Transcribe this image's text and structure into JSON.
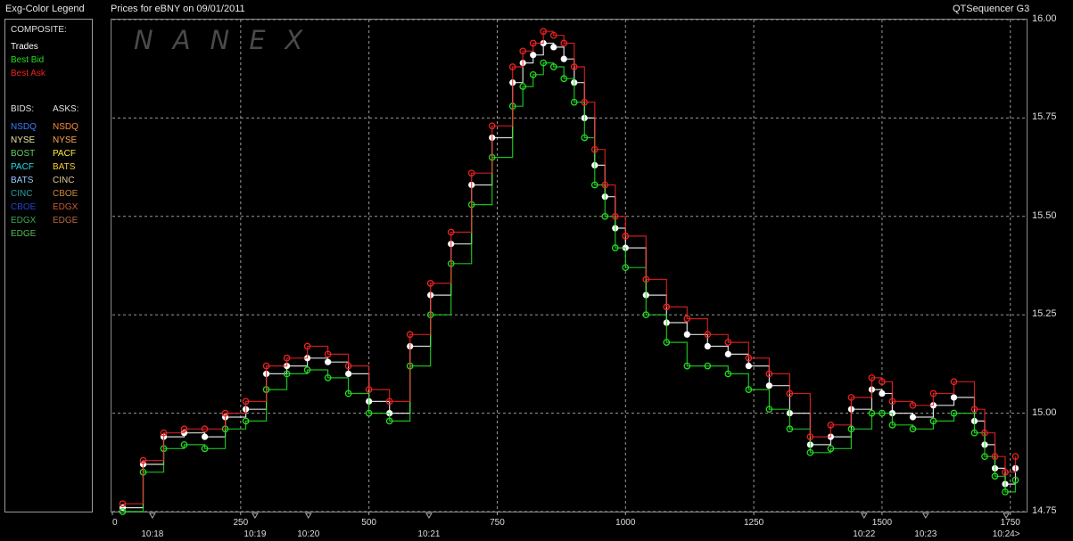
{
  "header": {
    "legend_title": "Exg-Color Legend",
    "chart_title": "Prices for  eBNY  on  09/01/2011",
    "app_name": "QTSequencer G3"
  },
  "watermark": "NANEX",
  "legend": {
    "composite_heading": "COMPOSITE:",
    "composite": [
      {
        "label": "Trades",
        "color": "#ffffff"
      },
      {
        "label": "Best Bid",
        "color": "#22dd22"
      },
      {
        "label": "Best Ask",
        "color": "#ee2222"
      }
    ],
    "bids_heading": "BIDS:",
    "asks_heading": "ASKS:",
    "bids": [
      {
        "label": "NSDQ",
        "color": "#3a7cff"
      },
      {
        "label": "NYSE",
        "color": "#e8e8a8"
      },
      {
        "label": "BOST",
        "color": "#66cc66"
      },
      {
        "label": "PACF",
        "color": "#22ddee"
      },
      {
        "label": "BATS",
        "color": "#99ccff"
      },
      {
        "label": "CINC",
        "color": "#22a0a0"
      },
      {
        "label": "CBOE",
        "color": "#2244cc"
      },
      {
        "label": "EDGX",
        "color": "#33aa55"
      },
      {
        "label": "EDGE",
        "color": "#55bb55"
      }
    ],
    "asks": [
      {
        "label": "NSDQ",
        "color": "#ff8833"
      },
      {
        "label": "NYSE",
        "color": "#ffaa55"
      },
      {
        "label": "PACF",
        "color": "#ffee44"
      },
      {
        "label": "BATS",
        "color": "#ffcc33"
      },
      {
        "label": "CINC",
        "color": "#ddcc99"
      },
      {
        "label": "CBOE",
        "color": "#cc8833"
      },
      {
        "label": "EDGX",
        "color": "#cc5533"
      },
      {
        "label": "EDGE",
        "color": "#bb6644"
      }
    ]
  },
  "chart_data": {
    "type": "line",
    "title": "Prices for  eBNY  on  09/01/2011",
    "xlim": [
      0,
      1780
    ],
    "ylim": [
      14.75,
      16.0
    ],
    "grid": true,
    "y_ticks": [
      "16.00",
      "15.75",
      "15.50",
      "15.25",
      "15.00",
      "14.75"
    ],
    "y_tick_values": [
      16.0,
      15.75,
      15.5,
      15.25,
      15.0,
      14.75
    ],
    "x_ticks": [
      "0",
      "250",
      "500",
      "750",
      "1000",
      "1250",
      "1500",
      "1750"
    ],
    "x_tick_values": [
      0,
      250,
      500,
      750,
      1000,
      1250,
      1500,
      1750
    ],
    "time_labels": [
      "10:18",
      "10:19",
      "10:20",
      "10:21",
      "10:22",
      "10:23",
      "10:24>"
    ],
    "time_label_positions": [
      78,
      278,
      382,
      617,
      1465,
      1585,
      1742
    ],
    "series": [
      {
        "name": "Trades",
        "color": "#ffffff",
        "x": [
          20,
          60,
          100,
          140,
          180,
          220,
          260,
          300,
          340,
          380,
          420,
          460,
          500,
          540,
          580,
          620,
          660,
          700,
          740,
          780,
          800,
          820,
          840,
          860,
          880,
          900,
          920,
          940,
          960,
          980,
          1000,
          1040,
          1080,
          1120,
          1160,
          1200,
          1240,
          1280,
          1320,
          1360,
          1400,
          1440,
          1480,
          1500,
          1520,
          1560,
          1600,
          1640,
          1680,
          1700,
          1720,
          1740,
          1760
        ],
        "values": [
          14.76,
          14.87,
          14.94,
          14.95,
          14.94,
          14.99,
          15.01,
          15.1,
          15.12,
          15.14,
          15.13,
          15.1,
          15.03,
          15.0,
          15.17,
          15.3,
          15.43,
          15.58,
          15.7,
          15.84,
          15.89,
          15.91,
          15.94,
          15.93,
          15.9,
          15.84,
          15.75,
          15.63,
          15.55,
          15.47,
          15.42,
          15.3,
          15.23,
          15.2,
          15.17,
          15.15,
          15.12,
          15.07,
          15.0,
          14.92,
          14.94,
          15.01,
          15.06,
          15.05,
          15.0,
          14.99,
          15.02,
          15.04,
          14.98,
          14.92,
          14.86,
          14.82,
          14.86
        ]
      },
      {
        "name": "Best Bid",
        "color": "#22dd22",
        "x": [
          20,
          60,
          100,
          140,
          180,
          220,
          260,
          300,
          340,
          380,
          420,
          460,
          500,
          540,
          580,
          620,
          660,
          700,
          740,
          780,
          800,
          820,
          840,
          860,
          880,
          900,
          920,
          940,
          960,
          980,
          1000,
          1040,
          1080,
          1120,
          1160,
          1200,
          1240,
          1280,
          1320,
          1360,
          1400,
          1440,
          1480,
          1500,
          1520,
          1560,
          1600,
          1640,
          1680,
          1700,
          1720,
          1740,
          1760
        ],
        "values": [
          14.75,
          14.85,
          14.91,
          14.92,
          14.91,
          14.96,
          14.98,
          15.06,
          15.1,
          15.11,
          15.09,
          15.05,
          15.0,
          14.98,
          15.12,
          15.25,
          15.38,
          15.53,
          15.65,
          15.78,
          15.83,
          15.86,
          15.89,
          15.88,
          15.85,
          15.79,
          15.7,
          15.58,
          15.5,
          15.42,
          15.37,
          15.25,
          15.18,
          15.12,
          15.12,
          15.1,
          15.06,
          15.01,
          14.96,
          14.9,
          14.91,
          14.96,
          15.0,
          15.0,
          14.97,
          14.96,
          14.98,
          15.0,
          14.95,
          14.89,
          14.84,
          14.8,
          14.83
        ]
      },
      {
        "name": "Best Ask",
        "color": "#ee2222",
        "x": [
          20,
          60,
          100,
          140,
          180,
          220,
          260,
          300,
          340,
          380,
          420,
          460,
          500,
          540,
          580,
          620,
          660,
          700,
          740,
          780,
          800,
          820,
          840,
          860,
          880,
          900,
          920,
          940,
          960,
          980,
          1000,
          1040,
          1080,
          1120,
          1160,
          1200,
          1240,
          1280,
          1320,
          1360,
          1400,
          1440,
          1480,
          1500,
          1520,
          1560,
          1600,
          1640,
          1680,
          1700,
          1720,
          1740,
          1760
        ],
        "values": [
          14.77,
          14.88,
          14.95,
          14.96,
          14.96,
          15.0,
          15.03,
          15.12,
          15.14,
          15.17,
          15.15,
          15.12,
          15.06,
          15.03,
          15.2,
          15.33,
          15.46,
          15.61,
          15.73,
          15.88,
          15.92,
          15.94,
          15.97,
          15.96,
          15.94,
          15.88,
          15.79,
          15.67,
          15.58,
          15.5,
          15.45,
          15.34,
          15.27,
          15.24,
          15.2,
          15.18,
          15.14,
          15.1,
          15.05,
          14.94,
          14.97,
          15.04,
          15.09,
          15.08,
          15.03,
          15.02,
          15.05,
          15.08,
          15.01,
          14.95,
          14.89,
          14.85,
          14.89
        ]
      }
    ]
  }
}
